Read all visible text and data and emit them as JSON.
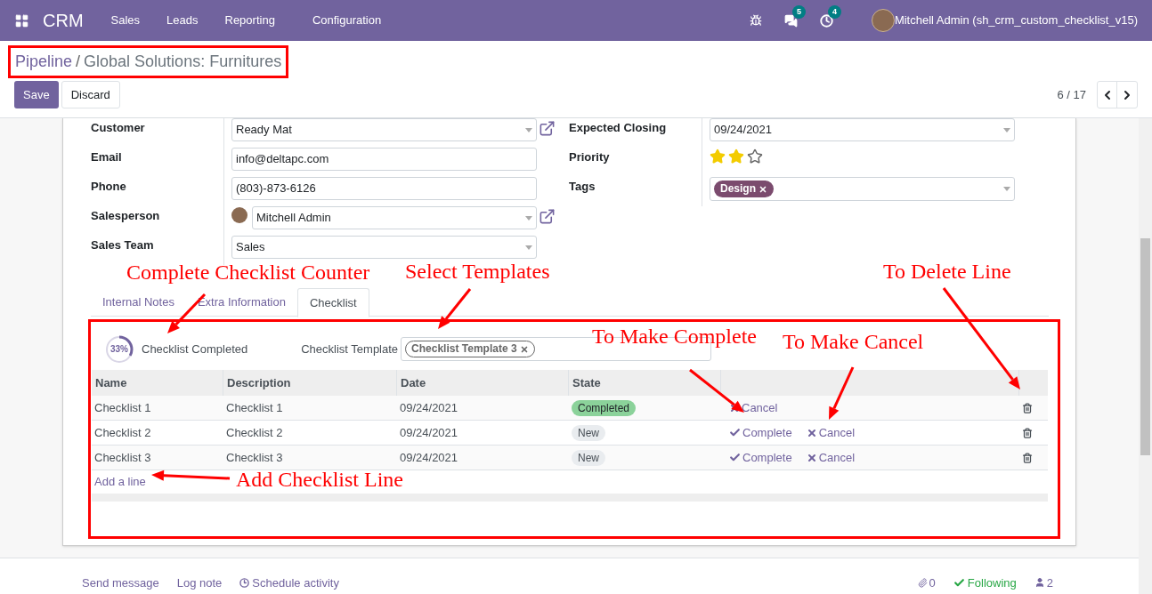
{
  "app_bar": {
    "app_name": "CRM",
    "menu": [
      "Sales",
      "Leads",
      "Reporting",
      "Configuration"
    ],
    "systray": [
      {
        "kind": "bug"
      },
      {
        "kind": "chat",
        "count": "5"
      },
      {
        "kind": "activity",
        "count": "4"
      }
    ],
    "user": "Mitchell Admin (sh_crm_custom_checklist_v15)"
  },
  "breadcrumb": {
    "parent": "Pipeline",
    "separator": "/",
    "current": "Global Solutions: Furnitures"
  },
  "buttons": [
    {
      "label": "Save",
      "kind": "primary"
    },
    {
      "label": "Discard",
      "kind": "secondary"
    }
  ],
  "pager": "6 / 17",
  "fields_left": [
    {
      "label": "Customer",
      "kind": "select",
      "value": "Ready Mat",
      "link": true,
      "avatar": false
    },
    {
      "label": "Email",
      "kind": "text",
      "value": "info@deltapc.com",
      "link": false,
      "avatar": false
    },
    {
      "label": "Phone",
      "kind": "text",
      "value": "(803)-873-6126",
      "link": false,
      "avatar": false
    },
    {
      "label": "Salesperson",
      "kind": "select",
      "value": "Mitchell Admin",
      "link": true,
      "avatar": true
    },
    {
      "label": "Sales Team",
      "kind": "select",
      "value": "Sales",
      "link": false,
      "avatar": false
    }
  ],
  "fields_right": [
    {
      "label": "Expected Closing",
      "kind": "select",
      "value": "09/24/2021"
    },
    {
      "label": "Priority",
      "kind": "stars",
      "stars": 2
    },
    {
      "label": "Tags",
      "kind": "tags",
      "tags": [
        "Design"
      ]
    }
  ],
  "tabs": [
    {
      "label": "Internal Notes",
      "selected": false
    },
    {
      "label": "Extra Information",
      "selected": false
    },
    {
      "label": "Checklist",
      "selected": true
    }
  ],
  "checklist": {
    "progress": "33%",
    "level": 0.33,
    "progress_label": "Checklist Completed",
    "template_label": "Checklist Template",
    "templates": [
      "Checklist Template 3"
    ],
    "columns": [
      "Name",
      "Description",
      "Date",
      "State"
    ],
    "rows": [
      {
        "name": "Checklist 1",
        "description": "Checklist 1",
        "date": "09/24/2021",
        "state": {
          "label": "Completed",
          "kind": "completed"
        },
        "actions": [
          {
            "kind": "cancel",
            "label": "Cancel"
          }
        ]
      },
      {
        "name": "Checklist 2",
        "description": "Checklist 2",
        "date": "09/24/2021",
        "state": {
          "label": "New",
          "kind": "new"
        },
        "actions": [
          {
            "kind": "complete",
            "label": "Complete"
          },
          {
            "kind": "cancel",
            "label": "Cancel"
          }
        ]
      },
      {
        "name": "Checklist 3",
        "description": "Checklist 3",
        "date": "09/24/2021",
        "state": {
          "label": "New",
          "kind": "new"
        },
        "actions": [
          {
            "kind": "complete",
            "label": "Complete"
          },
          {
            "kind": "cancel",
            "label": "Cancel"
          }
        ]
      }
    ],
    "add_line": "Add a line"
  },
  "chatter": {
    "actions": [
      "Send message",
      "Log note",
      "Schedule activity"
    ],
    "attachments": "0",
    "follow": "Following",
    "followers": "2"
  },
  "annotations": [
    "Complete Checklist Counter",
    "Select Templates",
    "To Delete Line",
    "To Make Complete",
    "To Make Cancel",
    "Add Checklist Line"
  ]
}
